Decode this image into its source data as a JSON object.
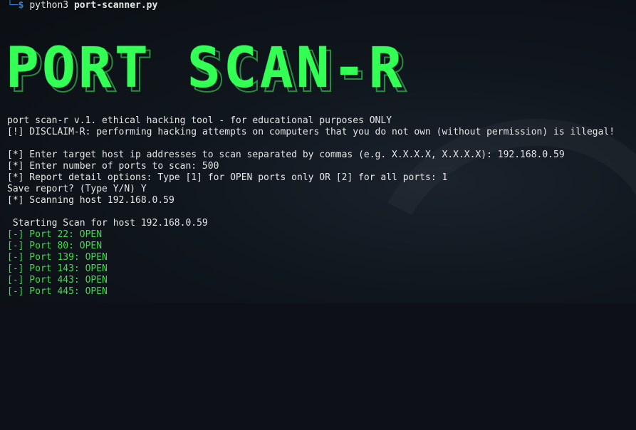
{
  "terminal": {
    "prompt": {
      "corner": "└─",
      "dollar": "$",
      "command": "python3",
      "argument": "port-scanner.py"
    },
    "banner": "PORT SCAN-R",
    "lines": [
      "port scan-r v.1. ethical hacking tool - for educational purposes ONLY",
      "[!] DISCLAIM-R: performing hacking attempts on computers that you do not own (without permission) is illegal!",
      "",
      "[*] Enter target host ip addresses to scan separated by commas (e.g. X.X.X.X, X.X.X.X): 192.168.0.59",
      "[*] Enter number of ports to scan: 500",
      "[*] Report detail options: Type [1] for OPEN ports only OR [2] for all ports: 1",
      "Save report? (Type Y/N) Y",
      "[*] Scanning host 192.168.0.59",
      "",
      " Starting Scan for host 192.168.0.59"
    ],
    "results": [
      "[-] Port 22: OPEN",
      "[-] Port 80: OPEN",
      "[-] Port 139: OPEN",
      "[-] Port 143: OPEN",
      "[-] Port 443: OPEN",
      "[-] Port 445: OPEN"
    ]
  },
  "colors": {
    "background": "#0d1117",
    "text": "#e6e6e6",
    "green": "#3fdc4f",
    "prompt": "#2f7fd6",
    "banner": "#33ff55"
  }
}
